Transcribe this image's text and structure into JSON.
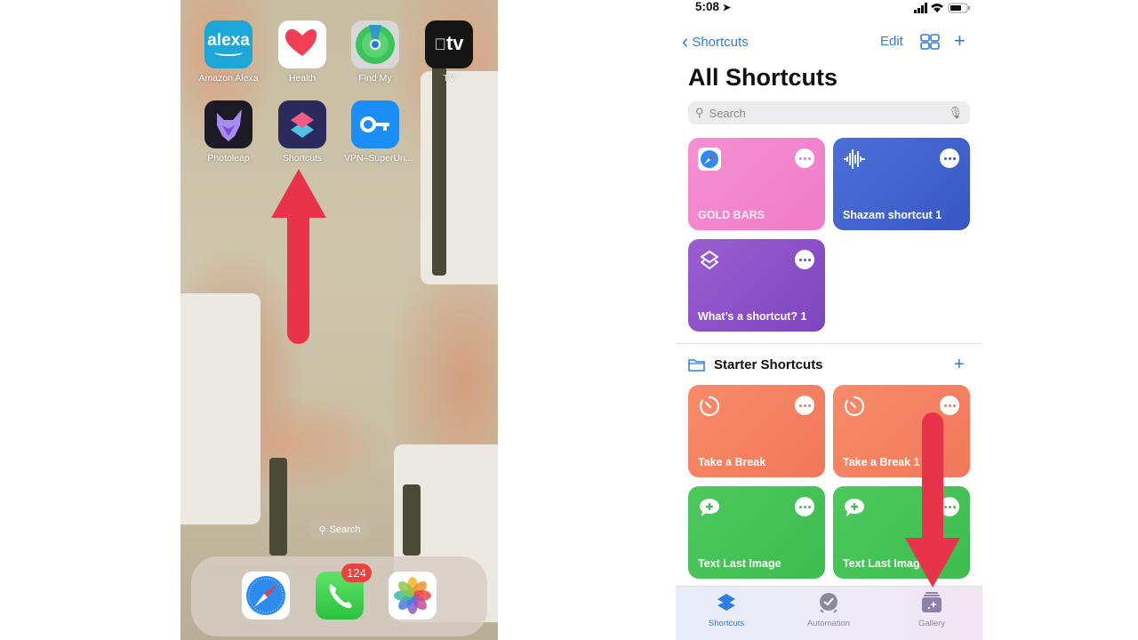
{
  "home_screen": {
    "apps": [
      {
        "name": "Amazon Alexa",
        "icon": "alexa-icon",
        "color": "#1ca7d8"
      },
      {
        "name": "Health",
        "icon": "heart-icon",
        "color": "#ffffff"
      },
      {
        "name": "Find My",
        "icon": "find-my-icon",
        "color": "#3cc45a"
      },
      {
        "name": "TV",
        "icon": "apple-tv-icon",
        "color": "#111111"
      },
      {
        "name": "Photoleap",
        "icon": "photoleap-icon",
        "color": "#1c1a24"
      },
      {
        "name": "Shortcuts",
        "icon": "shortcuts-icon",
        "color": "#2b2a5c"
      },
      {
        "name": "VPN–SuperUn...",
        "icon": "vpn-key-icon",
        "color": "#1a8ef5"
      }
    ],
    "alexa_text": "alexa",
    "tv_text": "tv",
    "search_label": "Search",
    "dock": [
      {
        "name": "Safari",
        "icon": "safari-icon"
      },
      {
        "name": "Phone",
        "icon": "phone-icon",
        "badge": "124"
      },
      {
        "name": "Photos",
        "icon": "photos-icon"
      }
    ],
    "annotation_color": "#e8334a"
  },
  "shortcuts_app": {
    "status": {
      "time": "5:08"
    },
    "nav": {
      "back_label": "Shortcuts",
      "edit_label": "Edit"
    },
    "title": "All Shortcuts",
    "search_placeholder": "Search",
    "shortcuts": [
      {
        "name": "GOLD BARS",
        "icon": "safari-icon",
        "color_from": "#f48fd2",
        "color_to": "#f07cc9"
      },
      {
        "name": "Shazam shortcut 1",
        "icon": "waveform-icon",
        "color_from": "#4d6fd6",
        "color_to": "#3857c4"
      },
      {
        "name": "What’s a shortcut? 1",
        "icon": "layers-icon",
        "color_from": "#9a5ed0",
        "color_to": "#7f45bf"
      }
    ],
    "section": {
      "title": "Starter Shortcuts",
      "items": [
        {
          "name": "Take a Break",
          "icon": "timer-icon",
          "color_from": "#f78b6a",
          "color_to": "#f2785a"
        },
        {
          "name": "Take a Break 1",
          "icon": "timer-icon",
          "color_from": "#f78b6a",
          "color_to": "#f2785a"
        },
        {
          "name": "Text Last Image",
          "icon": "message-plus-icon",
          "color_from": "#4cc85c",
          "color_to": "#3fbd50"
        },
        {
          "name": "Text Last Image",
          "icon": "message-plus-icon",
          "color_from": "#4cc85c",
          "color_to": "#3fbd50"
        }
      ]
    },
    "tabs": [
      {
        "label": "Shortcuts",
        "active": true
      },
      {
        "label": "Automation",
        "active": false
      },
      {
        "label": "Gallery",
        "active": false
      }
    ],
    "accent": "#2f7de0"
  }
}
